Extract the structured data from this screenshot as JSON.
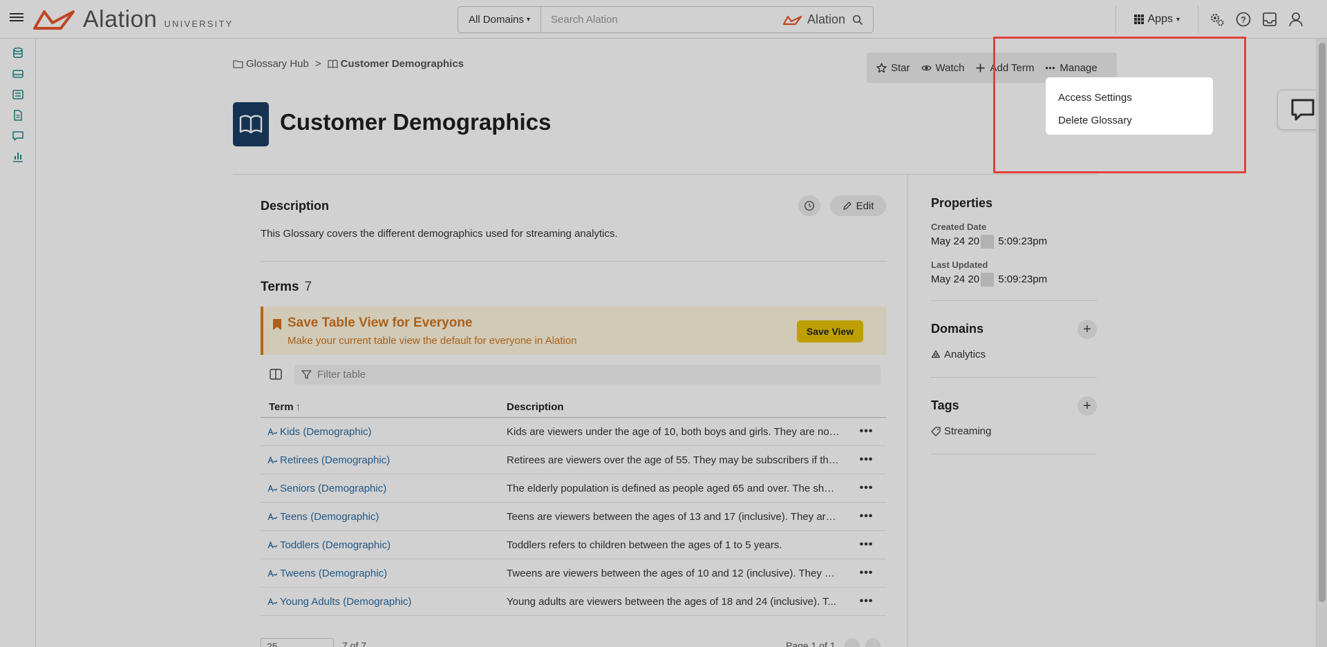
{
  "header": {
    "brand": "Alation",
    "brand_sub": "UNIVERSITY",
    "domain_select": "All Domains",
    "search_placeholder": "Search Alation",
    "search_brand": "Alation",
    "apps_label": "Apps"
  },
  "breadcrumb": {
    "parent": "Glossary Hub",
    "separator": ">",
    "current": "Customer Demographics"
  },
  "actions": {
    "star": "Star",
    "watch": "Watch",
    "add_term": "Add Term",
    "manage": "Manage"
  },
  "manage_menu": {
    "items": [
      "Access Settings",
      "Delete Glossary"
    ]
  },
  "page": {
    "title": "Customer Demographics"
  },
  "description": {
    "heading": "Description",
    "edit_label": "Edit",
    "text": "This Glossary covers the different demographics used for streaming analytics."
  },
  "terms": {
    "heading": "Terms",
    "count": "7",
    "banner": {
      "title": "Save Table View for Everyone",
      "subtitle": "Make your current table view the default for everyone in Alation",
      "button": "Save View"
    },
    "filter_placeholder": "Filter table",
    "columns": [
      "Term",
      "Description"
    ],
    "rows": [
      {
        "term": "Kids (Demographic)",
        "description": "Kids are viewers under the age of 10, both boys and girls. They are not ..."
      },
      {
        "term": "Retirees (Demographic)",
        "description": "Retirees are viewers over the age of 55. They may be subscribers if the..."
      },
      {
        "term": "Seniors (Demographic)",
        "description": "The elderly population is defined as people aged 65 and over. The shar..."
      },
      {
        "term": "Teens (Demographic)",
        "description": "Teens are viewers between the ages of 13 and 17 (inclusive). They are n..."
      },
      {
        "term": "Toddlers (Demographic)",
        "description": "Toddlers refers to children between the ages of 1 to 5 years."
      },
      {
        "term": "Tweens (Demographic)",
        "description": "Tweens are viewers between the ages of 10 and 12 (inclusive). They ar..."
      },
      {
        "term": "Young Adults (Demographic)",
        "description": "Young adults are viewers  between the ages of 18 and 24 (inclusive). T..."
      }
    ],
    "pager": {
      "page_size": "25",
      "count_text": "7 of 7",
      "page_text": "Page 1 of 1"
    }
  },
  "properties": {
    "heading": "Properties",
    "created_label": "Created Date",
    "created_prefix": "May 24 20",
    "created_suffix": " 5:09:23pm",
    "updated_label": "Last Updated",
    "updated_prefix": "May 24 20",
    "updated_suffix": " 5:09:23pm"
  },
  "domains": {
    "heading": "Domains",
    "items": [
      "Analytics"
    ]
  },
  "tags": {
    "heading": "Tags",
    "items": [
      "Streaming"
    ]
  },
  "colors": {
    "brand_orange": "#e8552b",
    "link_blue": "#2b6ca3",
    "teal": "#1a8a8a",
    "banner_bg": "#fff7e0",
    "banner_text": "#d3761e",
    "save_button": "#e8c300",
    "highlight_red": "#e1413c",
    "title_icon_bg": "#1a3d66"
  }
}
